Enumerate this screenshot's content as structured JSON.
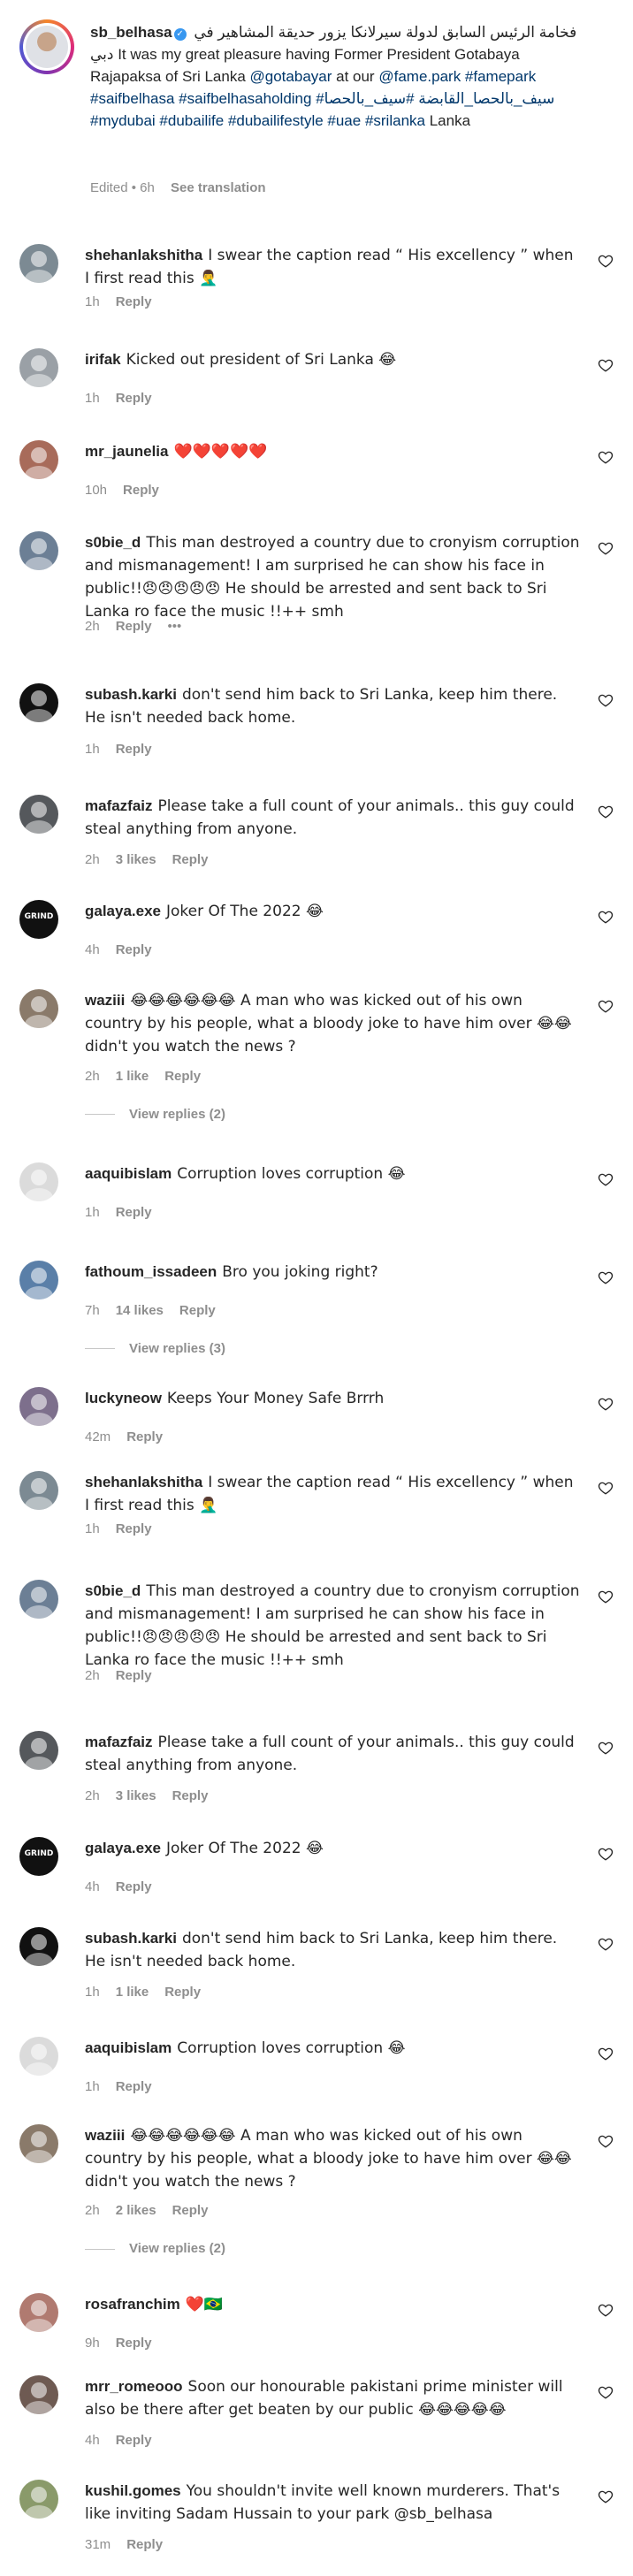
{
  "post": {
    "username": "sb_belhasa",
    "caption_text": "فخامة الرئيس السابق لدولة سيرلانكا يزور حديقة المشاهير في دبي It was my great pleasure having Former President Gotabaya Rajapaksa of Sri Lanka",
    "mention": "@gotabayar",
    "at_our": "at our",
    "hashtags": "@fame.park #famepark #saifbelhasa #saifbelhasaholding #سيف_بالحصا_القابضة #سيف_بالحصا #mydubai #dubailife #dubailifestyle #uae #srilanka",
    "location": "Lanka",
    "edited_time": "Edited • 6h",
    "see_translation": "See translation"
  },
  "comments": [
    {
      "username": "shehanlakshitha",
      "text": "I swear the caption read “ His excellency ” when I first read this 🤦‍♂️",
      "time": "1h",
      "likes": "",
      "reply": "Reply",
      "avatar_color": "#7c8a93"
    },
    {
      "username": "irifak",
      "text": "Kicked out president of Sri Lanka 😂",
      "time": "1h",
      "likes": "",
      "reply": "Reply",
      "avatar_color": "#9aa0a6"
    },
    {
      "username": "mr_jaunelia",
      "text": "❤️❤️❤️❤️❤️",
      "time": "10h",
      "likes": "",
      "reply": "Reply",
      "avatar_color": "#a86b5a"
    },
    {
      "username": "s0bie_d",
      "text": "This man destroyed a country due to cronyism corruption and mismanagement! I am surprised he can show his face in public!!😠😠😠😠😠 He should be arrested and sent back to Sri Lanka ro face the music !!++ smh",
      "time": "2h",
      "likes": "",
      "reply": "Reply",
      "more": "•••",
      "avatar_color": "#6c7f95"
    },
    {
      "username": "subash.karki",
      "text": "don't send him back to Sri Lanka, keep him there. He isn't needed back home.",
      "time": "1h",
      "likes": "",
      "reply": "Reply",
      "avatar_color": "#111111"
    },
    {
      "username": "mafazfaiz",
      "text": "Please take a full count of your animals.. this guy could steal anything from anyone.",
      "time": "2h",
      "likes": "3 likes",
      "reply": "Reply",
      "avatar_color": "#55585c"
    },
    {
      "username": "galaya.exe",
      "text": "Joker Of The 2022 😂",
      "time": "4h",
      "likes": "",
      "reply": "Reply",
      "avatar_color": "#111111",
      "logo": "GRIND"
    },
    {
      "username": "waziii",
      "text": "😂😂😂😂😂😂 A man who was kicked out of his own country by his people, what a bloody joke to have him over 😂😂 didn't you watch the news ?",
      "time": "2h",
      "likes": "1 like",
      "reply": "Reply",
      "avatar_color": "#8a7a6a"
    },
    {
      "username": "aaquibislam",
      "text": "Corruption loves corruption 😂",
      "time": "1h",
      "likes": "",
      "reply": "Reply",
      "avatar_color": "#dbdbdb"
    },
    {
      "username": "fathoum_issadeen",
      "text": "Bro you joking right?",
      "time": "7h",
      "likes": "14 likes",
      "reply": "Reply",
      "avatar_color": "#5a7fa8"
    },
    {
      "username": "luckyneow",
      "text": "Keeps Your Money Safe Brrrh",
      "time": "42m",
      "likes": "",
      "reply": "Reply",
      "avatar_color": "#7d6f8c"
    },
    {
      "username": "shehanlakshitha",
      "text": "I swear the caption read “ His excellency ” when I first read this 🤦‍♂️",
      "time": "1h",
      "likes": "",
      "reply": "Reply",
      "avatar_color": "#7c8a93"
    },
    {
      "username": "s0bie_d",
      "text": "This man destroyed a country due to cronyism corruption and mismanagement! I am surprised he can show his face in public!!😠😠😠😠😠 He should be arrested and sent back to Sri Lanka ro face the music !!++ smh",
      "time": "2h",
      "likes": "",
      "reply": "Reply",
      "avatar_color": "#6c7f95"
    },
    {
      "username": "mafazfaiz",
      "text": "Please take a full count of your animals.. this guy could steal anything from anyone.",
      "time": "2h",
      "likes": "3 likes",
      "reply": "Reply",
      "avatar_color": "#55585c"
    },
    {
      "username": "galaya.exe",
      "text": "Joker Of The 2022 😂",
      "time": "4h",
      "likes": "",
      "reply": "Reply",
      "avatar_color": "#111111",
      "logo": "GRIND"
    },
    {
      "username": "subash.karki",
      "text": "don't send him back to Sri Lanka, keep him there. He isn't needed back home.",
      "time": "1h",
      "likes": "1 like",
      "reply": "Reply",
      "avatar_color": "#111111"
    },
    {
      "username": "aaquibislam",
      "text": "Corruption loves corruption 😂",
      "time": "1h",
      "likes": "",
      "reply": "Reply",
      "avatar_color": "#dbdbdb"
    },
    {
      "username": "waziii",
      "text": "😂😂😂😂😂😂 A man who was kicked out of his own country by his people, what a bloody joke to have him over 😂😂 didn't you watch the news ?",
      "time": "2h",
      "likes": "2 likes",
      "reply": "Reply",
      "avatar_color": "#8a7a6a"
    },
    {
      "username": "rosafranchim",
      "text": "❤️🇧🇷",
      "time": "9h",
      "likes": "",
      "reply": "Reply",
      "avatar_color": "#b07a70"
    },
    {
      "username": "mrr_romeooo",
      "text": "Soon our honourable pakistani prime minister will also be there after get beaten by our public 😂😂😂😂😂",
      "time": "4h",
      "likes": "",
      "reply": "Reply",
      "avatar_color": "#6e5a52"
    },
    {
      "username": "kushil.gomes",
      "text": "You shouldn't invite well known murderers. That's like inviting Sadam Hussain to your park @sb_belhasa",
      "time": "31m",
      "likes": "",
      "reply": "Reply",
      "avatar_color": "#8a9a6a"
    }
  ],
  "view_replies": [
    "View replies (2)",
    "View replies (3)",
    "View replies (2)"
  ]
}
